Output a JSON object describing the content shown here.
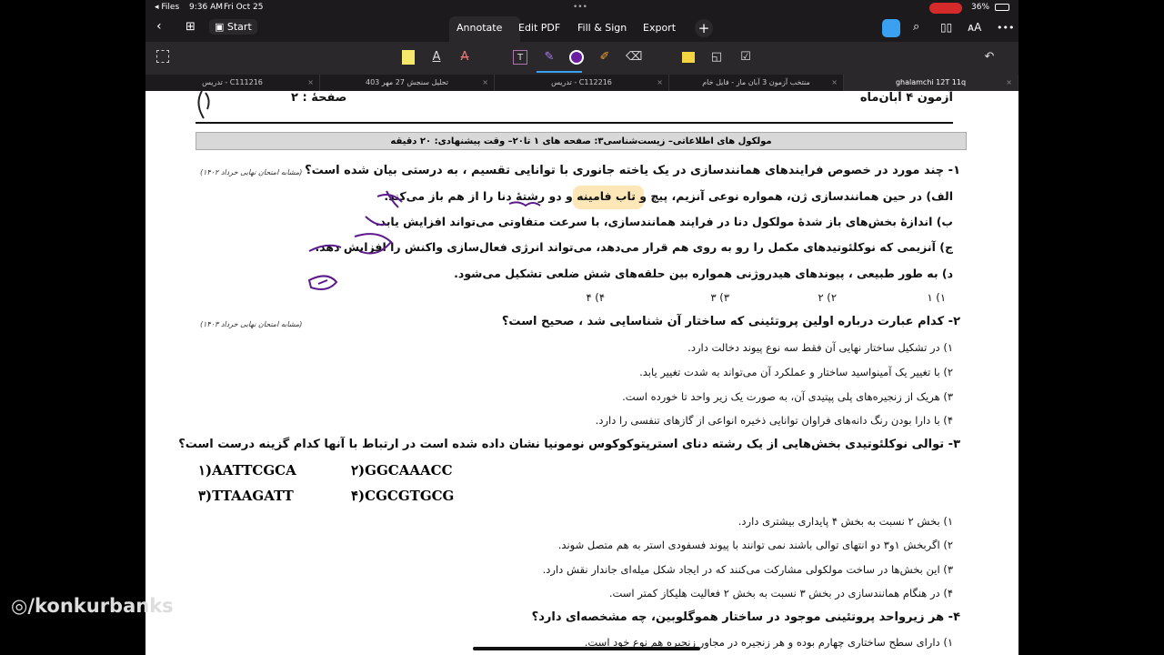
{
  "status": {
    "back_app": "◂ Files",
    "time": "9:36 AM",
    "date": "Fri Oct 25",
    "battery": "36%"
  },
  "toolbar": {
    "start": "Start",
    "tabs": [
      "Annotate",
      "Edit PDF",
      "Fill & Sign",
      "Export"
    ],
    "add": "+"
  },
  "doc_tabs": [
    {
      "label": "تدریس - C111216"
    },
    {
      "label": "تحلیل سنجش 27 مهر 403"
    },
    {
      "label": "تدریس - C112216"
    },
    {
      "label": "منتخب آزمون 3 آبان ماز - فایل خام"
    },
    {
      "label": "ghalamchi 12T 11q",
      "active": true
    }
  ],
  "page": {
    "exam_title": "آزمون ۴ آبان‌ماه",
    "page_no": "صفحهٔ : ۲",
    "section": "مولکول های اطلاعاتی– زیست‌شناسی۳: صفحه های ۱ تا۲۰– وقت پیشنهادی: ۲۰ دقیقه",
    "q1": {
      "text": "۱- چند مورد در خصوص فرایندهای همانندسازی در یک یاخته جانوری با توانایی تقسیم ، به درستی بیان شده است؟",
      "note": "(مشابه امتحان نهایی خرداد ۱۴۰۲)",
      "options": [
        "الف) در حین همانندسازی ژن، همواره نوعی آنزیم، پیچ و تاب فامینه و دو رشتهٔ دنا را از هم باز می‌کند.",
        "ب) اندازهٔ بخش‌های باز شدهٔ مولکول دنا در فرایند همانندسازی، با سرعت متفاوتی می‌تواند افزایش یابد.",
        "ج) آنزیمی که نوکلئوتیدهای مکمل را رو به روی هم قرار می‌دهد، می‌تواند انرژی فعال‌سازی واکنش را افزایش دهد.",
        "د) به طور طبیعی ، پیوندهای هیدروژنی همواره بین حلقه‌های شش ضلعی تشکیل می‌شود."
      ],
      "choices": [
        "۱) ۱",
        "۲) ۲",
        "۳) ۳",
        "۴) ۴"
      ]
    },
    "q2": {
      "text": "۲- کدام عبارت درباره اولین پروتئینی که ساختار آن شناسایی شد ، صحیح است؟",
      "note": "(مشابه امتحان نهایی خرداد ۱۴۰۳)",
      "options": [
        "۱) در تشکیل ساختار نهایی آن فقط سه نوع پیوند دخالت دارد.",
        "۲) با تغییر یک آمینواسید ساختار و عملکرد آن می‌تواند به شدت تغییر یابد.",
        "۳) هریک از زنجیره‌های پلی پپتیدی آن، به صورت یک زیر واحد تا خورده است.",
        "۴) با دارا بودن رنگ دانه‌های فراوان توانایی ذخیره انواعی از گازهای تنفسی را دارد."
      ]
    },
    "q3": {
      "text": "۳- توالی نوکلئوتیدی بخش‌هایی از یک رشته دنای استرپتوکوکوس نومونیا نشان داده شده است در ارتباط با آنها کدام گزینه درست است؟",
      "sequences": [
        "۱)AATTCGCA",
        "۲)GGCAAACC",
        "۳)TTAAGATT",
        "۴)CGCGTGCG"
      ],
      "options": [
        "۱) بخش ۲ نسبت به بخش ۴ پایداری بیشتری دارد.",
        "۲) اگربخش ۱و۳ دو انتهای توالی باشند نمی توانند با پیوند فسفودی استر به هم متصل شوند.",
        "۳) این بخش‌ها در ساخت مولکولی مشارکت می‌کنند که در ایجاد شکل میله‌ای جاندار نقش دارد.",
        "۴) در هنگام همانندسازی در بخش ۳ نسبت به بخش ۲ فعالیت هلیکاز کمتر است."
      ]
    },
    "q4": {
      "text": "۴- هر زیرواحد پروتئینی موجود در ساختار هموگلوبین، چه مشخصه‌ای دارد؟",
      "options": [
        "۱) دارای سطح ساختاری چهارم بوده و هر زنجیره در مجاور زنجیره هم نوع خود است."
      ]
    }
  },
  "watermark": "/konkurbanks"
}
